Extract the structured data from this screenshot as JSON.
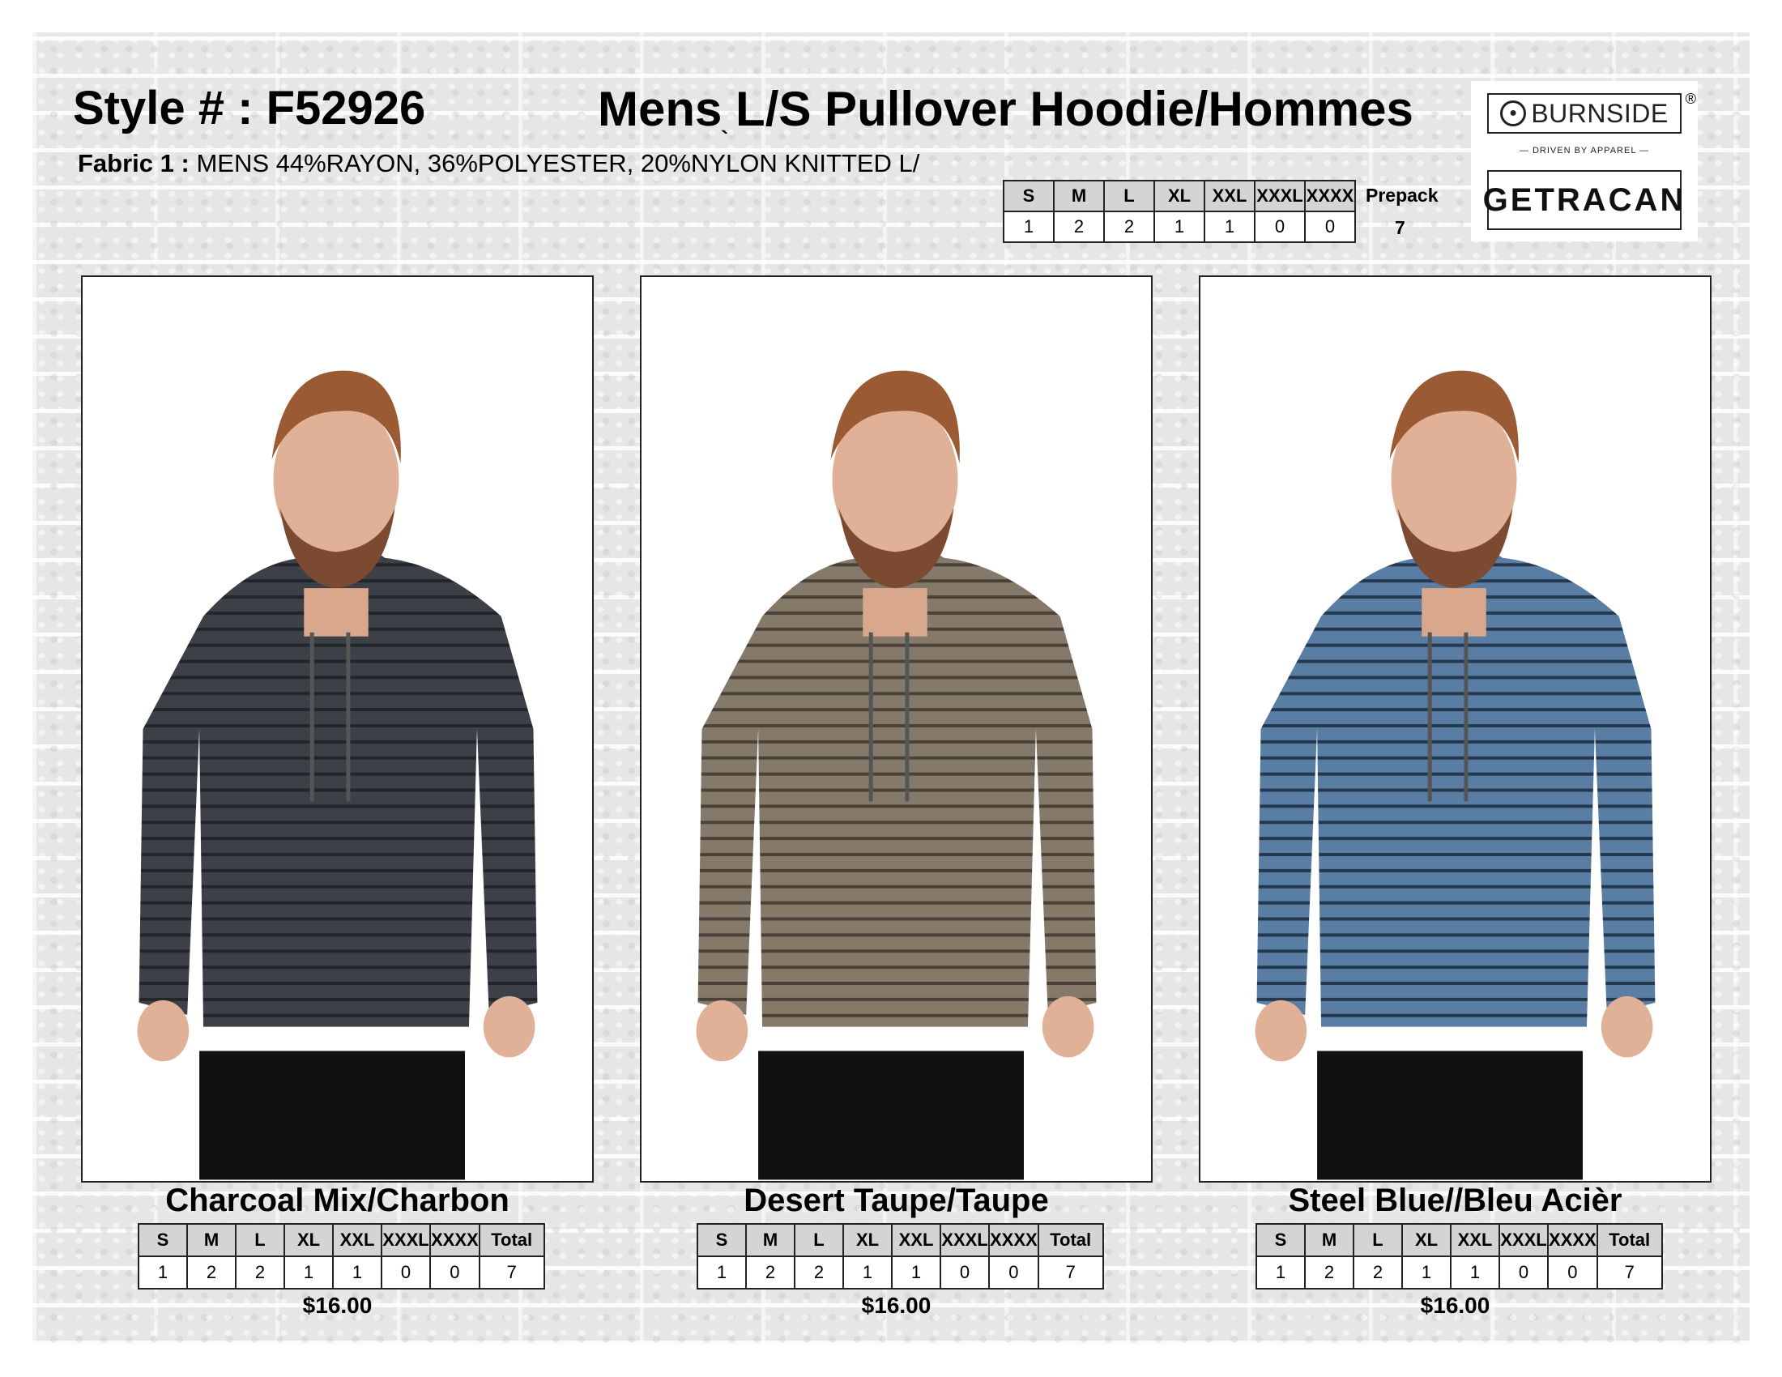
{
  "header": {
    "style_label": "Style # :",
    "style_number": "F52926",
    "title": "Mens L/S Pullover Hoodie/Hommes",
    "title_accent": "`",
    "fabric_label": "Fabric 1 :",
    "fabric_text": "MENS 44%RAYON, 36%POLYESTER, 20%NYLON KNITTED L/"
  },
  "logo": {
    "brand1": "BURNSIDE",
    "registered": "®",
    "tagline": "— DRIVEN BY APPAREL —",
    "brand2": "GETRACAN"
  },
  "prepack": {
    "sizes": [
      "S",
      "M",
      "L",
      "XL",
      "XXL",
      "XXXL",
      "XXXX"
    ],
    "qty": [
      "1",
      "2",
      "2",
      "1",
      "1",
      "0",
      "0"
    ],
    "label": "Prepack",
    "total": "7"
  },
  "variants": [
    {
      "color_name": "Charcoal Mix/Charbon",
      "swatch": "#3d4147",
      "stripe": "#22252a",
      "sizes": [
        "S",
        "M",
        "L",
        "XL",
        "XXL",
        "XXXL",
        "XXXX",
        "Total"
      ],
      "qty": [
        "1",
        "2",
        "2",
        "1",
        "1",
        "0",
        "0",
        "7"
      ],
      "price": "$16.00"
    },
    {
      "color_name": "Desert Taupe/Taupe",
      "swatch": "#857a6a",
      "stripe": "#4a4238",
      "sizes": [
        "S",
        "M",
        "L",
        "XL",
        "XXL",
        "XXXL",
        "XXXX",
        "Total"
      ],
      "qty": [
        "1",
        "2",
        "2",
        "1",
        "1",
        "0",
        "0",
        "7"
      ],
      "price": "$16.00"
    },
    {
      "color_name": "Steel Blue//Bleu Acièr",
      "swatch": "#5a7ea3",
      "stripe": "#24384f",
      "sizes": [
        "S",
        "M",
        "L",
        "XL",
        "XXL",
        "XXXL",
        "XXXX",
        "Total"
      ],
      "qty": [
        "1",
        "2",
        "2",
        "1",
        "1",
        "0",
        "0",
        "7"
      ],
      "price": "$16.00"
    }
  ]
}
